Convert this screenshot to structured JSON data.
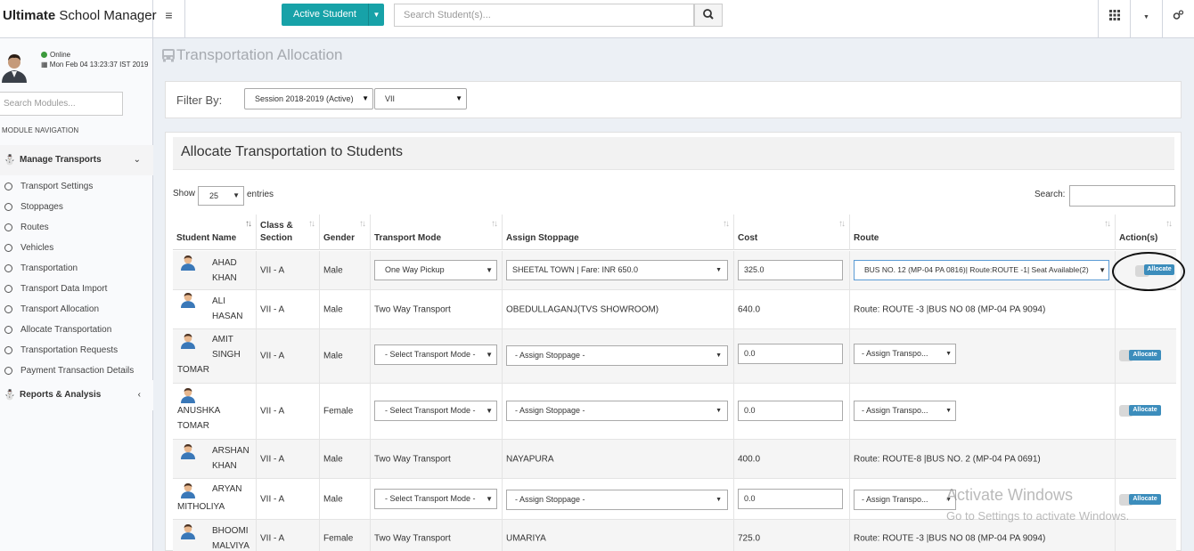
{
  "app": {
    "brand_bold": "Ultimate",
    "brand_rest": " School Manager"
  },
  "topbar": {
    "active_student": "Active Student",
    "search_placeholder": "Search Student(s)..."
  },
  "sidebar": {
    "status": "Online",
    "datetime": "Mon Feb 04 13:23:37 IST 2019",
    "search_placeholder": "Search Modules...",
    "module_nav": "MODULE NAVIGATION",
    "group_manage": "Manage Transports",
    "items": [
      "Transport Settings",
      "Stoppages",
      "Routes",
      "Vehicles",
      "Transportation",
      "Transport Data Import",
      "Transport Allocation",
      "Allocate Transportation",
      "Transportation Requests",
      "Payment Transaction Details"
    ],
    "group_reports": "Reports & Analysis"
  },
  "page": {
    "title": "Transportation Allocation",
    "filter_label": "Filter By:",
    "session": "Session 2018-2019 (Active)",
    "class": "VII"
  },
  "box": {
    "title": "Allocate Transportation to Students",
    "show": "Show",
    "length": "25",
    "entries": "entries",
    "search": "Search:"
  },
  "columns": {
    "student": "Student Name",
    "class_1": "Class &",
    "class_2": "Section",
    "gender": "Gender",
    "mode": "Transport Mode",
    "stoppage": "Assign Stoppage",
    "cost": "Cost",
    "route": "Route",
    "action": "Action(s)"
  },
  "rows": [
    {
      "name1": "AHAD",
      "name2": "KHAN",
      "name3": "",
      "class": "VII - A",
      "gender": "Male",
      "mode": "One Way Pickup",
      "stoppage": "SHEETAL TOWN | Fare: INR 650.0",
      "cost": "325.0",
      "route": "BUS NO. 12 (MP-04 PA 0816)| Route:ROUTE -1| Seat Available(2)",
      "action": "Allocate"
    },
    {
      "name1": "ALI",
      "name2": "HASAN",
      "name3": "",
      "class": "VII - A",
      "gender": "Male",
      "mode": "Two Way Transport",
      "stoppage": "OBEDULLAGANJ(TVS SHOWROOM)",
      "cost": "640.0",
      "route": "Route: ROUTE -3 |BUS NO 08 (MP-04 PA 9094)",
      "action": ""
    },
    {
      "name1": "AMIT",
      "name2": "SINGH",
      "name3": "TOMAR",
      "class": "VII - A",
      "gender": "Male",
      "mode": "- Select Transport Mode -",
      "stoppage": "- Assign Stoppage -",
      "cost": "0.0",
      "route": "- Assign Transpo...",
      "action": "Allocate"
    },
    {
      "name1": "ANUSHKA",
      "name2": "TOMAR",
      "name3": "",
      "class": "VII - A",
      "gender": "Female",
      "mode": "- Select Transport Mode -",
      "stoppage": "- Assign Stoppage -",
      "cost": "0.0",
      "route": "- Assign Transpo...",
      "action": "Allocate"
    },
    {
      "name1": "ARSHAN",
      "name2": "KHAN",
      "name3": "",
      "class": "VII - A",
      "gender": "Male",
      "mode": "Two Way Transport",
      "stoppage": "NAYAPURA",
      "cost": "400.0",
      "route": "Route: ROUTE-8 |BUS NO. 2 (MP-04 PA 0691)",
      "action": ""
    },
    {
      "name1": "ARYAN",
      "name2": "MITHOLIYA",
      "name3": "",
      "class": "VII - A",
      "gender": "Male",
      "mode": "- Select Transport Mode -",
      "stoppage": "- Assign Stoppage -",
      "cost": "0.0",
      "route": "- Assign Transpo...",
      "action": "Allocate"
    },
    {
      "name1": "BHOOMI",
      "name2": "MALVIYA",
      "name3": "",
      "class": "VII - A",
      "gender": "Female",
      "mode": "Two Way Transport",
      "stoppage": "UMARIYA",
      "cost": "725.0",
      "route": "Route: ROUTE -3 |BUS NO 08 (MP-04 PA 9094)",
      "action": ""
    }
  ],
  "watermark": {
    "line1": "Activate Windows",
    "line2": "Go to Settings to activate Windows."
  }
}
